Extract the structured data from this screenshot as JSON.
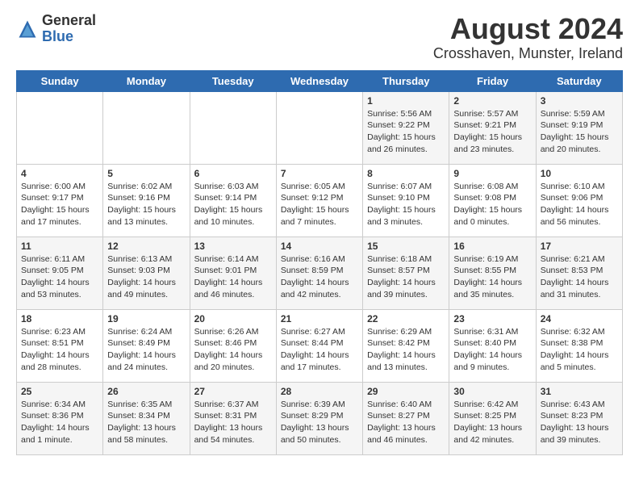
{
  "header": {
    "logo_line1": "General",
    "logo_line2": "Blue",
    "title": "August 2024",
    "subtitle": "Crosshaven, Munster, Ireland"
  },
  "calendar": {
    "days_of_week": [
      "Sunday",
      "Monday",
      "Tuesday",
      "Wednesday",
      "Thursday",
      "Friday",
      "Saturday"
    ],
    "weeks": [
      [
        {
          "day": "",
          "content": ""
        },
        {
          "day": "",
          "content": ""
        },
        {
          "day": "",
          "content": ""
        },
        {
          "day": "",
          "content": ""
        },
        {
          "day": "1",
          "content": "Sunrise: 5:56 AM\nSunset: 9:22 PM\nDaylight: 15 hours\nand 26 minutes."
        },
        {
          "day": "2",
          "content": "Sunrise: 5:57 AM\nSunset: 9:21 PM\nDaylight: 15 hours\nand 23 minutes."
        },
        {
          "day": "3",
          "content": "Sunrise: 5:59 AM\nSunset: 9:19 PM\nDaylight: 15 hours\nand 20 minutes."
        }
      ],
      [
        {
          "day": "4",
          "content": "Sunrise: 6:00 AM\nSunset: 9:17 PM\nDaylight: 15 hours\nand 17 minutes."
        },
        {
          "day": "5",
          "content": "Sunrise: 6:02 AM\nSunset: 9:16 PM\nDaylight: 15 hours\nand 13 minutes."
        },
        {
          "day": "6",
          "content": "Sunrise: 6:03 AM\nSunset: 9:14 PM\nDaylight: 15 hours\nand 10 minutes."
        },
        {
          "day": "7",
          "content": "Sunrise: 6:05 AM\nSunset: 9:12 PM\nDaylight: 15 hours\nand 7 minutes."
        },
        {
          "day": "8",
          "content": "Sunrise: 6:07 AM\nSunset: 9:10 PM\nDaylight: 15 hours\nand 3 minutes."
        },
        {
          "day": "9",
          "content": "Sunrise: 6:08 AM\nSunset: 9:08 PM\nDaylight: 15 hours\nand 0 minutes."
        },
        {
          "day": "10",
          "content": "Sunrise: 6:10 AM\nSunset: 9:06 PM\nDaylight: 14 hours\nand 56 minutes."
        }
      ],
      [
        {
          "day": "11",
          "content": "Sunrise: 6:11 AM\nSunset: 9:05 PM\nDaylight: 14 hours\nand 53 minutes."
        },
        {
          "day": "12",
          "content": "Sunrise: 6:13 AM\nSunset: 9:03 PM\nDaylight: 14 hours\nand 49 minutes."
        },
        {
          "day": "13",
          "content": "Sunrise: 6:14 AM\nSunset: 9:01 PM\nDaylight: 14 hours\nand 46 minutes."
        },
        {
          "day": "14",
          "content": "Sunrise: 6:16 AM\nSunset: 8:59 PM\nDaylight: 14 hours\nand 42 minutes."
        },
        {
          "day": "15",
          "content": "Sunrise: 6:18 AM\nSunset: 8:57 PM\nDaylight: 14 hours\nand 39 minutes."
        },
        {
          "day": "16",
          "content": "Sunrise: 6:19 AM\nSunset: 8:55 PM\nDaylight: 14 hours\nand 35 minutes."
        },
        {
          "day": "17",
          "content": "Sunrise: 6:21 AM\nSunset: 8:53 PM\nDaylight: 14 hours\nand 31 minutes."
        }
      ],
      [
        {
          "day": "18",
          "content": "Sunrise: 6:23 AM\nSunset: 8:51 PM\nDaylight: 14 hours\nand 28 minutes."
        },
        {
          "day": "19",
          "content": "Sunrise: 6:24 AM\nSunset: 8:49 PM\nDaylight: 14 hours\nand 24 minutes."
        },
        {
          "day": "20",
          "content": "Sunrise: 6:26 AM\nSunset: 8:46 PM\nDaylight: 14 hours\nand 20 minutes."
        },
        {
          "day": "21",
          "content": "Sunrise: 6:27 AM\nSunset: 8:44 PM\nDaylight: 14 hours\nand 17 minutes."
        },
        {
          "day": "22",
          "content": "Sunrise: 6:29 AM\nSunset: 8:42 PM\nDaylight: 14 hours\nand 13 minutes."
        },
        {
          "day": "23",
          "content": "Sunrise: 6:31 AM\nSunset: 8:40 PM\nDaylight: 14 hours\nand 9 minutes."
        },
        {
          "day": "24",
          "content": "Sunrise: 6:32 AM\nSunset: 8:38 PM\nDaylight: 14 hours\nand 5 minutes."
        }
      ],
      [
        {
          "day": "25",
          "content": "Sunrise: 6:34 AM\nSunset: 8:36 PM\nDaylight: 14 hours\nand 1 minute."
        },
        {
          "day": "26",
          "content": "Sunrise: 6:35 AM\nSunset: 8:34 PM\nDaylight: 13 hours\nand 58 minutes."
        },
        {
          "day": "27",
          "content": "Sunrise: 6:37 AM\nSunset: 8:31 PM\nDaylight: 13 hours\nand 54 minutes."
        },
        {
          "day": "28",
          "content": "Sunrise: 6:39 AM\nSunset: 8:29 PM\nDaylight: 13 hours\nand 50 minutes."
        },
        {
          "day": "29",
          "content": "Sunrise: 6:40 AM\nSunset: 8:27 PM\nDaylight: 13 hours\nand 46 minutes."
        },
        {
          "day": "30",
          "content": "Sunrise: 6:42 AM\nSunset: 8:25 PM\nDaylight: 13 hours\nand 42 minutes."
        },
        {
          "day": "31",
          "content": "Sunrise: 6:43 AM\nSunset: 8:23 PM\nDaylight: 13 hours\nand 39 minutes."
        }
      ]
    ]
  }
}
